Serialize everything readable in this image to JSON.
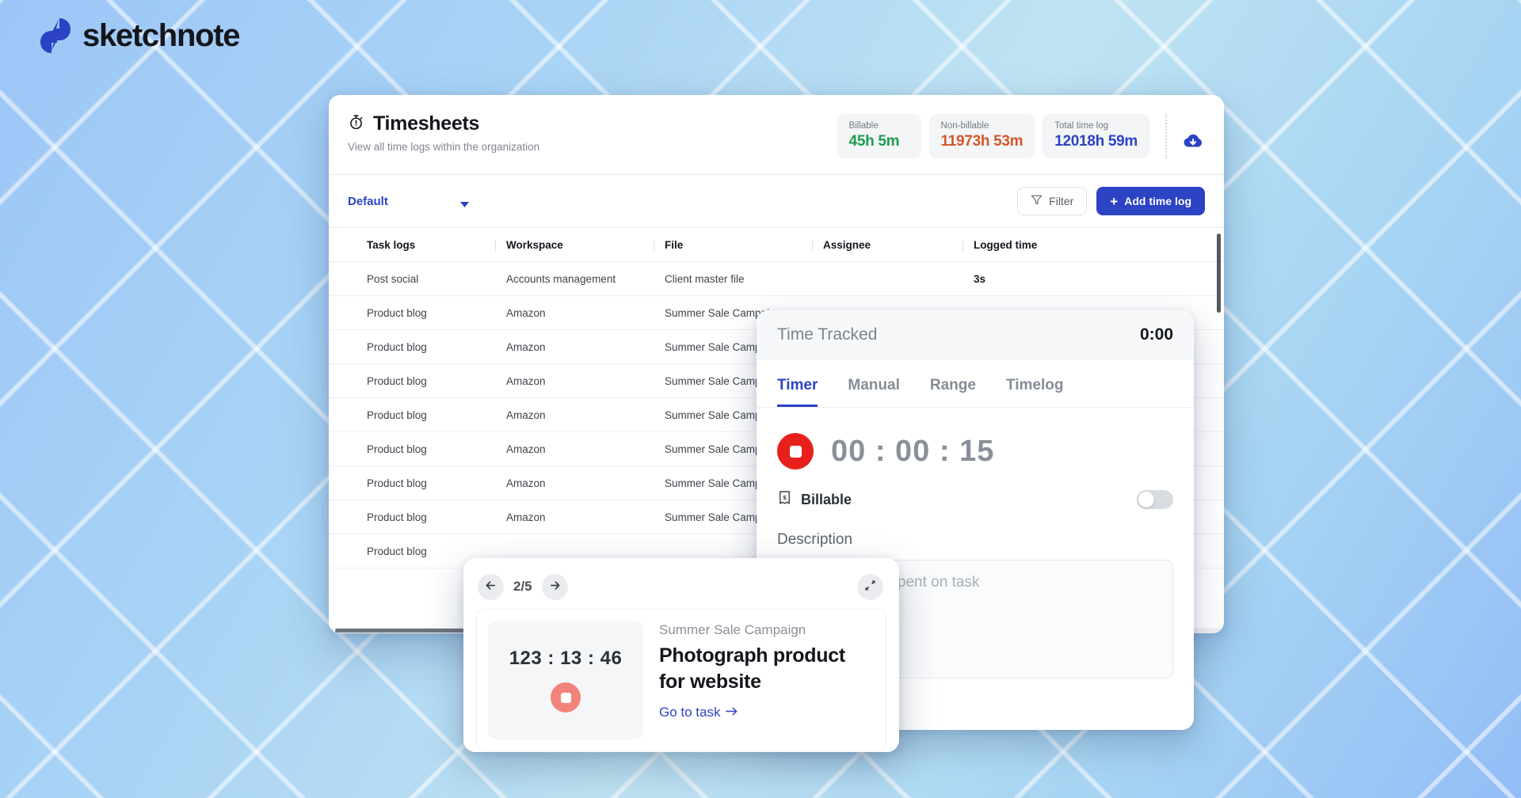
{
  "brand": {
    "name": "sketchnote",
    "logo_icon": "lightning-bolt-icon",
    "logo_color": "#2c43c4"
  },
  "app": {
    "header": {
      "title": "Timesheets",
      "subtitle": "View all time logs within the organization",
      "title_icon": "stopwatch-icon",
      "download_icon": "cloud-download-icon",
      "stats": [
        {
          "label": "Billable",
          "value": "45h 5m",
          "color": "#1a9e4b"
        },
        {
          "label": "Non-billable",
          "value": "11973h 53m",
          "color": "#d4572a"
        },
        {
          "label": "Total time log",
          "value": "12018h 59m",
          "color": "#2c43c4"
        }
      ]
    },
    "toolbar": {
      "view_name": "Default",
      "view_caret_icon": "chevron-down-icon",
      "filter_label": "Filter",
      "filter_icon": "funnel-icon",
      "add_label": "Add time log",
      "add_icon": "plus-icon"
    },
    "table": {
      "columns": [
        "Task logs",
        "Workspace",
        "File",
        "Assignee",
        "Logged time"
      ],
      "rows": [
        {
          "task": "Post social",
          "workspace": "Accounts management",
          "file": "Client master file",
          "assignee": "",
          "logged": "3s"
        },
        {
          "task": "Product blog",
          "workspace": "Amazon",
          "file": "Summer Sale Campaign",
          "assignee": "",
          "logged": ""
        },
        {
          "task": "Product blog",
          "workspace": "Amazon",
          "file": "Summer Sale Campaign",
          "assignee": "",
          "logged": ""
        },
        {
          "task": "Product blog",
          "workspace": "Amazon",
          "file": "Summer Sale Campaign",
          "assignee": "",
          "logged": ""
        },
        {
          "task": "Product blog",
          "workspace": "Amazon",
          "file": "Summer Sale Campaign",
          "assignee": "",
          "logged": ""
        },
        {
          "task": "Product blog",
          "workspace": "Amazon",
          "file": "Summer Sale Campaign",
          "assignee": "",
          "logged": ""
        },
        {
          "task": "Product blog",
          "workspace": "Amazon",
          "file": "Summer Sale Campaign",
          "assignee": "",
          "logged": ""
        },
        {
          "task": "Product blog",
          "workspace": "Amazon",
          "file": "Summer Sale Campaign",
          "assignee": "",
          "logged": ""
        },
        {
          "task": "Product blog",
          "workspace": "",
          "file": "",
          "assignee": "",
          "logged": ""
        }
      ]
    }
  },
  "time_tracked": {
    "title": "Time Tracked",
    "total": "0:00",
    "tabs": [
      {
        "label": "Timer",
        "active": true
      },
      {
        "label": "Manual",
        "active": false
      },
      {
        "label": "Range",
        "active": false
      },
      {
        "label": "Timelog",
        "active": false
      }
    ],
    "timer_value": "00 : 00 : 15",
    "stop_icon": "stop-icon",
    "billable_label": "Billable",
    "billable_icon": "receipt-dollar-icon",
    "billable_on": false,
    "description_label": "Description",
    "description_placeholder": "Describe time spent on task",
    "description_value": ""
  },
  "mini_timer": {
    "page_indicator": "2/5",
    "prev_icon": "arrow-left-icon",
    "next_icon": "arrow-right-icon",
    "collapse_icon": "collapse-arrows-icon",
    "elapsed": "123 : 13 : 46",
    "stop_icon": "stop-icon",
    "workspace": "Summer Sale Campaign",
    "task": "Photograph product for website",
    "link_label": "Go to task",
    "link_icon": "arrow-right-icon"
  }
}
